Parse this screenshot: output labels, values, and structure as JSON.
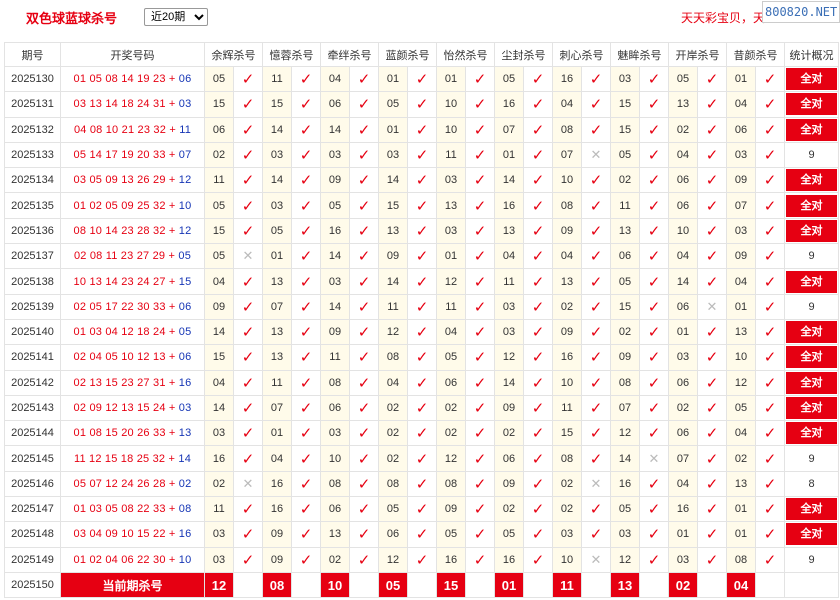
{
  "header": {
    "title": "双色球蓝球杀号",
    "period_select": "近20期",
    "promo_text": "天天彩宝贝，天",
    "watermark": "800820.NET"
  },
  "columns": {
    "period": "期号",
    "draw": "开奖号码",
    "experts": [
      "余辉杀号",
      "憶蓉杀号",
      "牵绊杀号",
      "蓝颜杀号",
      "怡然杀号",
      "尘封杀号",
      "刺心杀号",
      "魅眸杀号",
      "开岸杀号",
      "昔颜杀号"
    ],
    "summary": "统计概况"
  },
  "marks": {
    "hit": "✓",
    "miss": "✕"
  },
  "all_correct_label": "全对",
  "rows": [
    {
      "period": "2025130",
      "red": "01 05 08 14 19 23",
      "plus": "+",
      "blue": "06",
      "kills": [
        "05",
        "11",
        "04",
        "01",
        "01",
        "05",
        "16",
        "03",
        "05",
        "01"
      ],
      "hits": [
        1,
        1,
        1,
        1,
        1,
        1,
        1,
        1,
        1,
        1
      ],
      "summary": "全对"
    },
    {
      "period": "2025131",
      "red": "03 13 14 18 24 31",
      "plus": "+",
      "blue": "03",
      "kills": [
        "15",
        "15",
        "06",
        "05",
        "10",
        "16",
        "04",
        "15",
        "13",
        "04"
      ],
      "hits": [
        1,
        1,
        1,
        1,
        1,
        1,
        1,
        1,
        1,
        1
      ],
      "summary": "全对"
    },
    {
      "period": "2025132",
      "red": "04 08 10 21 23 32",
      "plus": "+",
      "blue": "11",
      "kills": [
        "06",
        "14",
        "14",
        "01",
        "10",
        "07",
        "08",
        "15",
        "02",
        "06"
      ],
      "hits": [
        1,
        1,
        1,
        1,
        1,
        1,
        1,
        1,
        1,
        1
      ],
      "summary": "全对"
    },
    {
      "period": "2025133",
      "red": "05 14 17 19 20 33",
      "plus": "+",
      "blue": "07",
      "kills": [
        "02",
        "03",
        "03",
        "03",
        "11",
        "01",
        "07",
        "05",
        "04",
        "03"
      ],
      "hits": [
        1,
        1,
        1,
        1,
        1,
        1,
        0,
        1,
        1,
        1
      ],
      "summary": "9"
    },
    {
      "period": "2025134",
      "red": "03 05 09 13 26 29",
      "plus": "+",
      "blue": "12",
      "kills": [
        "11",
        "14",
        "09",
        "14",
        "03",
        "14",
        "10",
        "02",
        "06",
        "09"
      ],
      "hits": [
        1,
        1,
        1,
        1,
        1,
        1,
        1,
        1,
        1,
        1
      ],
      "summary": "全对"
    },
    {
      "period": "2025135",
      "red": "01 02 05 09 25 32",
      "plus": "+",
      "blue": "10",
      "kills": [
        "05",
        "03",
        "05",
        "15",
        "13",
        "16",
        "08",
        "11",
        "06",
        "07"
      ],
      "hits": [
        1,
        1,
        1,
        1,
        1,
        1,
        1,
        1,
        1,
        1
      ],
      "summary": "全对"
    },
    {
      "period": "2025136",
      "red": "08 10 14 23 28 32",
      "plus": "+",
      "blue": "12",
      "kills": [
        "15",
        "05",
        "16",
        "13",
        "03",
        "13",
        "09",
        "13",
        "10",
        "03"
      ],
      "hits": [
        1,
        1,
        1,
        1,
        1,
        1,
        1,
        1,
        1,
        1
      ],
      "summary": "全对"
    },
    {
      "period": "2025137",
      "red": "02 08 11 23 27 29",
      "plus": "+",
      "blue": "05",
      "kills": [
        "05",
        "01",
        "14",
        "09",
        "01",
        "04",
        "04",
        "06",
        "04",
        "09"
      ],
      "hits": [
        0,
        1,
        1,
        1,
        1,
        1,
        1,
        1,
        1,
        1
      ],
      "summary": "9"
    },
    {
      "period": "2025138",
      "red": "10 13 14 23 24 27",
      "plus": "+",
      "blue": "15",
      "kills": [
        "04",
        "13",
        "03",
        "14",
        "12",
        "11",
        "13",
        "05",
        "14",
        "04"
      ],
      "hits": [
        1,
        1,
        1,
        1,
        1,
        1,
        1,
        1,
        1,
        1
      ],
      "summary": "全对"
    },
    {
      "period": "2025139",
      "red": "02 05 17 22 30 33",
      "plus": "+",
      "blue": "06",
      "kills": [
        "09",
        "07",
        "14",
        "11",
        "11",
        "03",
        "02",
        "15",
        "06",
        "01"
      ],
      "hits": [
        1,
        1,
        1,
        1,
        1,
        1,
        1,
        1,
        0,
        1
      ],
      "summary": "9"
    },
    {
      "period": "2025140",
      "red": "01 03 04 12 18 24",
      "plus": "+",
      "blue": "05",
      "kills": [
        "14",
        "13",
        "09",
        "12",
        "04",
        "03",
        "09",
        "02",
        "01",
        "13"
      ],
      "hits": [
        1,
        1,
        1,
        1,
        1,
        1,
        1,
        1,
        1,
        1
      ],
      "summary": "全对"
    },
    {
      "period": "2025141",
      "red": "02 04 05 10 12 13",
      "plus": "+",
      "blue": "06",
      "kills": [
        "15",
        "13",
        "11",
        "08",
        "05",
        "12",
        "16",
        "09",
        "03",
        "10"
      ],
      "hits": [
        1,
        1,
        1,
        1,
        1,
        1,
        1,
        1,
        1,
        1
      ],
      "summary": "全对"
    },
    {
      "period": "2025142",
      "red": "02 13 15 23 27 31",
      "plus": "+",
      "blue": "16",
      "kills": [
        "04",
        "11",
        "08",
        "04",
        "06",
        "14",
        "10",
        "08",
        "06",
        "12"
      ],
      "hits": [
        1,
        1,
        1,
        1,
        1,
        1,
        1,
        1,
        1,
        1
      ],
      "summary": "全对"
    },
    {
      "period": "2025143",
      "red": "02 09 12 13 15 24",
      "plus": "+",
      "blue": "03",
      "kills": [
        "14",
        "07",
        "06",
        "02",
        "02",
        "09",
        "11",
        "07",
        "02",
        "05"
      ],
      "hits": [
        1,
        1,
        1,
        1,
        1,
        1,
        1,
        1,
        1,
        1
      ],
      "summary": "全对"
    },
    {
      "period": "2025144",
      "red": "01 08 15 20 26 33",
      "plus": "+",
      "blue": "13",
      "kills": [
        "03",
        "01",
        "03",
        "02",
        "02",
        "02",
        "15",
        "12",
        "06",
        "04"
      ],
      "hits": [
        1,
        1,
        1,
        1,
        1,
        1,
        1,
        1,
        1,
        1
      ],
      "summary": "全对"
    },
    {
      "period": "2025145",
      "red": "11 12 15 18 25 32",
      "plus": "+",
      "blue": "14",
      "kills": [
        "16",
        "04",
        "10",
        "02",
        "12",
        "06",
        "08",
        "14",
        "07",
        "02"
      ],
      "hits": [
        1,
        1,
        1,
        1,
        1,
        1,
        1,
        0,
        1,
        1
      ],
      "summary": "9"
    },
    {
      "period": "2025146",
      "red": "05 07 12 24 26 28",
      "plus": "+",
      "blue": "02",
      "kills": [
        "02",
        "16",
        "08",
        "08",
        "08",
        "09",
        "02",
        "16",
        "04",
        "13"
      ],
      "hits": [
        0,
        1,
        1,
        1,
        1,
        1,
        0,
        1,
        1,
        1
      ],
      "summary": "8"
    },
    {
      "period": "2025147",
      "red": "01 03 05 08 22 33",
      "plus": "+",
      "blue": "08",
      "kills": [
        "11",
        "16",
        "06",
        "05",
        "09",
        "02",
        "02",
        "05",
        "16",
        "01"
      ],
      "hits": [
        1,
        1,
        1,
        1,
        1,
        1,
        1,
        1,
        1,
        1
      ],
      "summary": "全对"
    },
    {
      "period": "2025148",
      "red": "03 04 09 10 15 22",
      "plus": "+",
      "blue": "16",
      "kills": [
        "03",
        "09",
        "13",
        "06",
        "05",
        "05",
        "03",
        "03",
        "01",
        "01"
      ],
      "hits": [
        1,
        1,
        1,
        1,
        1,
        1,
        1,
        1,
        1,
        1
      ],
      "summary": "全对"
    },
    {
      "period": "2025149",
      "red": "01 02 04 06 22 30",
      "plus": "+",
      "blue": "10",
      "kills": [
        "03",
        "09",
        "02",
        "12",
        "16",
        "16",
        "10",
        "12",
        "03",
        "08"
      ],
      "hits": [
        1,
        1,
        1,
        1,
        1,
        1,
        0,
        1,
        1,
        1
      ],
      "summary": "9"
    }
  ],
  "current": {
    "period": "2025150",
    "label": "当前期杀号",
    "kills": [
      "12",
      "08",
      "10",
      "05",
      "15",
      "01",
      "11",
      "13",
      "02",
      "04"
    ]
  }
}
